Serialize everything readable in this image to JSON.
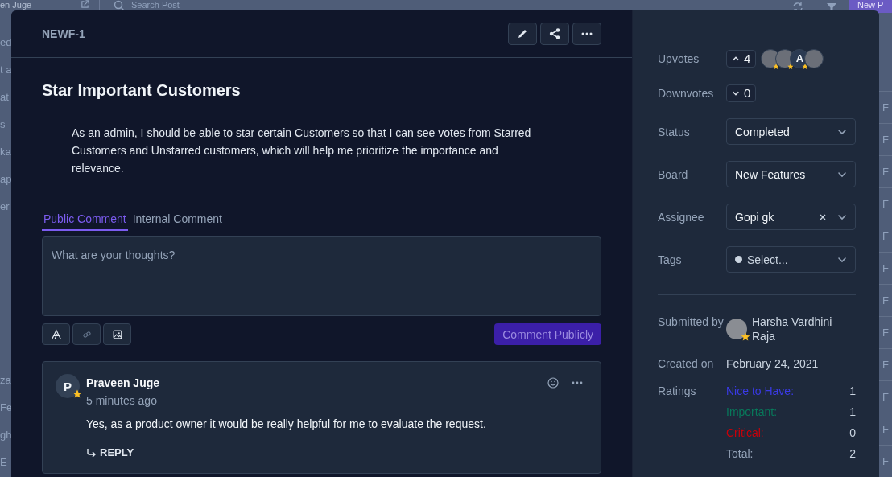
{
  "background": {
    "user_name": "en Juge",
    "search": {
      "placeholder": "Search Post"
    },
    "new_button": "New P",
    "left_top": [
      "ed",
      "t a",
      "at",
      "s",
      "ka",
      "ap",
      "er"
    ],
    "left_bottom": [
      "za",
      "Fe",
      "gh",
      "E"
    ],
    "right_column": [
      "F",
      "F",
      "F",
      "F",
      "F",
      "F",
      "F",
      "F",
      "F",
      "F",
      "F",
      "F"
    ]
  },
  "post": {
    "id": "NEWF-1",
    "title": "Star Important Customers",
    "description": "As an admin, I should be able to star certain Customers so that I can see votes from Starred Customers and Unstarred customers, which will help me prioritize the importance and relevance.",
    "tabs": [
      {
        "label": "Public Comment",
        "selected": true
      },
      {
        "label": "Internal Comment",
        "selected": false
      }
    ],
    "comment_box": {
      "placeholder": "What are your thoughts?"
    },
    "submit_button": "Comment Publicly",
    "comments": [
      {
        "initial": "P",
        "starred": true,
        "author": "Praveen Juge",
        "time": "5 minutes ago",
        "text": "Yes, as a product owner it would be really helpful for me to evaluate the request.",
        "reply": "REPLY"
      }
    ]
  },
  "sidebar": {
    "upvotes": {
      "label": "Upvotes",
      "count": "4",
      "voters": [
        {
          "kind": "photo",
          "starred": true
        },
        {
          "kind": "photo",
          "starred": true
        },
        {
          "kind": "letter",
          "initial": "A",
          "starred": true
        },
        {
          "kind": "photo",
          "starred": false
        }
      ]
    },
    "downvotes": {
      "label": "Downvotes",
      "count": "0"
    },
    "fields": [
      {
        "label": "Status",
        "value": "Completed",
        "clearable": false,
        "kind": "value"
      },
      {
        "label": "Board",
        "value": "New Features",
        "clearable": false,
        "kind": "value"
      },
      {
        "label": "Assignee",
        "value": "Gopi gk",
        "clearable": true,
        "kind": "value"
      },
      {
        "label": "Tags",
        "placeholder": "Select...",
        "clearable": false,
        "kind": "tags"
      }
    ],
    "submitted_by": {
      "label": "Submitted by",
      "name": "Harsha Vardhini Raja",
      "starred": true
    },
    "created_on": {
      "label": "Created on",
      "value": "February 24, 2021"
    },
    "ratings": {
      "label": "Ratings",
      "items": [
        {
          "name": "Nice to Have:",
          "count": "1",
          "color": "#3a3ae6"
        },
        {
          "name": "Important:",
          "count": "1",
          "color": "#08785a"
        },
        {
          "name": "Critical:",
          "count": "0",
          "color": "#c8000a"
        },
        {
          "name": "Total:",
          "count": "2",
          "color": "#94a3b8"
        }
      ]
    }
  }
}
